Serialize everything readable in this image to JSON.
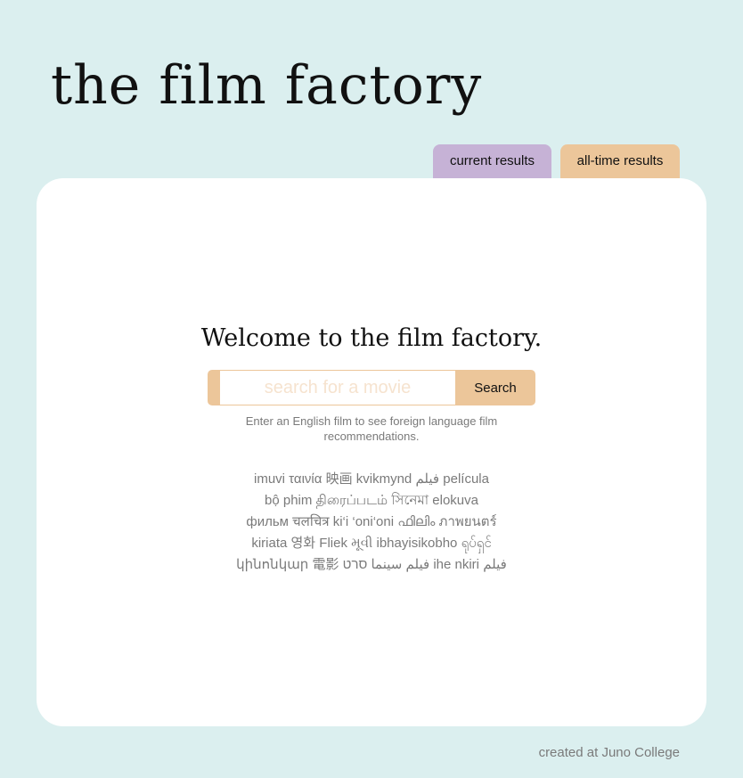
{
  "header": {
    "title": "the film factory"
  },
  "tabs": [
    {
      "label": "current results",
      "color": "#c6b2d6"
    },
    {
      "label": "all-time results",
      "color": "#ecc69a"
    }
  ],
  "main": {
    "welcome": "Welcome to the film factory.",
    "search": {
      "placeholder": "search for a movie",
      "value": "",
      "button_label": "Search"
    },
    "hint": "Enter an English film to see foreign language film recommendations.",
    "film_words_lines": [
      "imuvi ταινία 映画 kvikmynd فيلم película",
      "bộ phim திரைப்படம் সিনেমা elokuva",
      "фильм चलचित्र ki‘i ‘oni‘oni ഫിലിം ภาพยนตร์",
      "kiriata 영화 Fliek મૂવી ibhayisikobho ရုပ်ရှင်",
      "կինոնկար 電影 فیلم سینما סרט ihe nkiri فيلم"
    ]
  },
  "footer": {
    "text": "created at Juno College"
  },
  "colors": {
    "background": "#dbefef",
    "card": "#ffffff",
    "accent_purple": "#c6b2d6",
    "accent_tan": "#ecc69a"
  }
}
